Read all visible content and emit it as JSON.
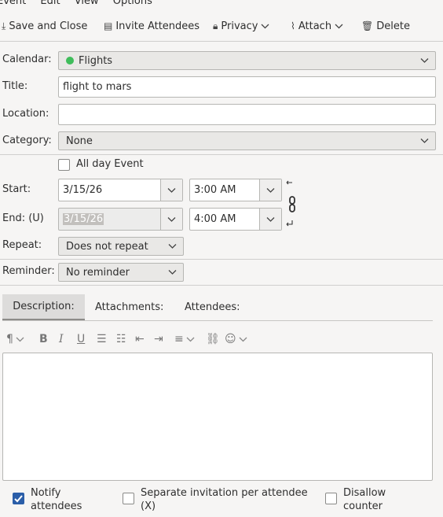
{
  "menu": [
    "Event",
    "Edit",
    "View",
    "Options"
  ],
  "toolbar": {
    "save_close": "Save and Close",
    "invite": "Invite Attendees",
    "privacy": "Privacy",
    "attach": "Attach",
    "delete": "Delete"
  },
  "form": {
    "calendar_label": "Calendar:",
    "calendar_value": "Flights",
    "calendar_color": "#3fbd5b",
    "title_label": "Title:",
    "title_value": "flight to mars",
    "location_label": "Location:",
    "location_value": "",
    "category_label": "Category:",
    "category_value": "None",
    "all_day_label": "All day Event",
    "start_label": "Start:",
    "start_date": "3/15/26",
    "start_time": "3:00 AM",
    "end_label": "End: (U)",
    "end_date": "3/15/26",
    "end_time": "4:00 AM",
    "repeat_label": "Repeat:",
    "repeat_value": "Does not repeat",
    "reminder_label": "Reminder:",
    "reminder_value": "No reminder"
  },
  "tabs": {
    "description": "Description:",
    "attachments": "Attachments:",
    "attendees": "Attendees:"
  },
  "format_toolbar": {
    "icons": [
      "paragraph-icon",
      "bold-icon",
      "italic-icon",
      "underline-icon",
      "bullet-list-icon",
      "numbered-list-icon",
      "outdent-icon",
      "indent-icon",
      "align-icon",
      "link-icon",
      "emoji-icon"
    ]
  },
  "footer": {
    "notify_label": "Notify attendees",
    "notify_checked": true,
    "separate_label": "Separate invitation per attendee (X)",
    "disallow_label": "Disallow counter"
  }
}
